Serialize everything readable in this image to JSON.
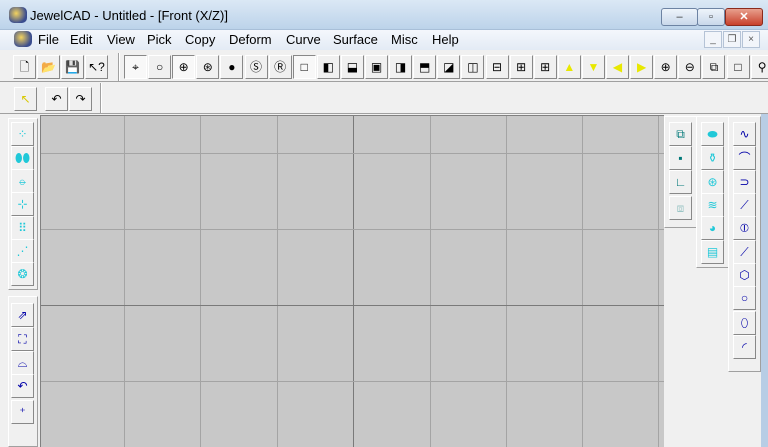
{
  "window": {
    "title": "JewelCAD - Untitled - [Front (X/Z)]",
    "minimize": "‒",
    "maximize": "▫",
    "close": "✕"
  },
  "mdi": {
    "minimize": "_",
    "restore": "❐",
    "close": "×"
  },
  "menu": [
    "File",
    "Edit",
    "View",
    "Pick",
    "Copy",
    "Deform",
    "Curve",
    "Surface",
    "Misc",
    "Help"
  ],
  "toolbar1": [
    {
      "name": "new-file",
      "glyph": "🗋"
    },
    {
      "name": "open-folder",
      "glyph": "📂"
    },
    {
      "name": "save",
      "glyph": "💾"
    },
    {
      "name": "context-help",
      "glyph": "↖?"
    },
    {
      "name": "pick-point",
      "glyph": "⌖",
      "pressed": true
    },
    {
      "name": "wireframe-circle",
      "glyph": "○"
    },
    {
      "name": "wire-sphere",
      "glyph": "⊕",
      "pressed": true
    },
    {
      "name": "mesh-sphere",
      "glyph": "⊛"
    },
    {
      "name": "shaded-sphere",
      "glyph": "●"
    },
    {
      "name": "smooth-render",
      "glyph": "Ⓢ"
    },
    {
      "name": "realistic-render",
      "glyph": "Ⓡ"
    },
    {
      "name": "view-single",
      "glyph": "□",
      "pressed": true
    },
    {
      "name": "view-left",
      "glyph": "◧"
    },
    {
      "name": "view-bottom",
      "glyph": "⬓"
    },
    {
      "name": "view-frame",
      "glyph": "▣"
    },
    {
      "name": "view-right",
      "glyph": "◨"
    },
    {
      "name": "view-top",
      "glyph": "⬒"
    },
    {
      "name": "view-bottom-left",
      "glyph": "◪"
    },
    {
      "name": "split-vertical",
      "glyph": "◫"
    },
    {
      "name": "split-horizontal",
      "glyph": "⊟"
    },
    {
      "name": "quad-view",
      "glyph": "⊞"
    },
    {
      "name": "quad-view-bold",
      "glyph": "⊞"
    },
    {
      "name": "rotate-up",
      "glyph": "▲",
      "color": "#e8e800"
    },
    {
      "name": "rotate-down",
      "glyph": "▼",
      "color": "#e8e800"
    },
    {
      "name": "rotate-left",
      "glyph": "◀",
      "color": "#e8e800"
    },
    {
      "name": "rotate-right",
      "glyph": "▶",
      "color": "#e8e800"
    },
    {
      "name": "zoom-in",
      "glyph": "⊕"
    },
    {
      "name": "zoom-out",
      "glyph": "⊖"
    },
    {
      "name": "zoom-window",
      "glyph": "⧉"
    },
    {
      "name": "fit-view",
      "glyph": "□"
    },
    {
      "name": "more",
      "glyph": "⚲"
    }
  ],
  "toolbar2": [
    {
      "name": "select-arrow",
      "glyph": "↖",
      "color": "#d8c800"
    },
    {
      "name": "undo",
      "glyph": "↶"
    },
    {
      "name": "redo",
      "glyph": "↷"
    }
  ],
  "left_tools": [
    {
      "name": "pick-points",
      "glyph": "⁘"
    },
    {
      "name": "mirror-horizontal",
      "glyph": "⬮⬮"
    },
    {
      "name": "mirror-vertical",
      "glyph": "⦵"
    },
    {
      "name": "mirror-quadrant",
      "glyph": "⊹"
    },
    {
      "name": "array-grid",
      "glyph": "⠿"
    },
    {
      "name": "linear-array",
      "glyph": "⋰"
    },
    {
      "name": "radial-array",
      "glyph": "❂"
    },
    {
      "name": "move-to",
      "glyph": "⇗"
    },
    {
      "name": "scale-fit",
      "glyph": "⛶"
    },
    {
      "name": "arch",
      "glyph": "⌓"
    },
    {
      "name": "rotate-copy",
      "glyph": "↶"
    },
    {
      "name": "scatter-points",
      "glyph": "⁺"
    }
  ],
  "right_col1": [
    {
      "name": "union",
      "glyph": "⧉"
    },
    {
      "name": "point",
      "glyph": "▪"
    },
    {
      "name": "corner",
      "glyph": "∟"
    },
    {
      "name": "disabled-box",
      "glyph": "⧈",
      "disabled": true
    }
  ],
  "right_col2": [
    {
      "name": "extrude-surface",
      "glyph": "⬬"
    },
    {
      "name": "revolve-surface",
      "glyph": "⚱"
    },
    {
      "name": "sweep-surface",
      "glyph": "⊛"
    },
    {
      "name": "tube-surface",
      "glyph": "≋"
    },
    {
      "name": "loft-surface",
      "glyph": "◕"
    },
    {
      "name": "rail-surface",
      "glyph": "▤"
    }
  ],
  "right_col3": [
    {
      "name": "free-curve",
      "glyph": "∿"
    },
    {
      "name": "symmetric-curve",
      "glyph": "⌒"
    },
    {
      "name": "mirror-curve",
      "glyph": "⊃"
    },
    {
      "name": "step-curve",
      "glyph": "⟋"
    },
    {
      "name": "ellipse-curve",
      "glyph": "⦶"
    },
    {
      "name": "line-curve",
      "glyph": "⟋"
    },
    {
      "name": "polygon-curve",
      "glyph": "⬡"
    },
    {
      "name": "circle",
      "glyph": "○"
    },
    {
      "name": "ellipse",
      "glyph": "⬯"
    },
    {
      "name": "arc",
      "glyph": "◜"
    }
  ],
  "colors": {
    "icon": "#0000a8",
    "cyan": "#20c8d8",
    "teal": "#007878",
    "canvas": "#c8c8c8"
  }
}
